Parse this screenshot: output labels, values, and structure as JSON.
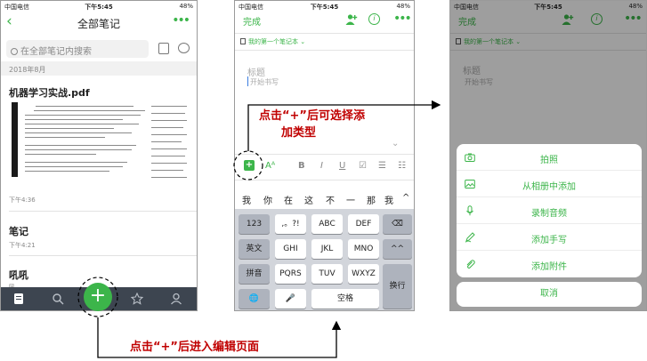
{
  "status_bar": {
    "carrier": "中国电信",
    "time": "下午5:45",
    "battery": "48%"
  },
  "screen_list": {
    "title": "全部笔记",
    "more": "•••",
    "search_placeholder": "在全部笔记内搜索",
    "date_header": "2018年8月",
    "notes": [
      {
        "title": "机器学习实战.pdf",
        "time": "下午4:36"
      },
      {
        "title": "笔记",
        "time": "下午4:21"
      },
      {
        "title": "吼吼",
        "time": "吼 "
      }
    ],
    "fab_label": "+"
  },
  "screen_editor": {
    "done": "完成",
    "info": "i",
    "more": "•••",
    "notebook": "我的第一个笔记本 ⌄",
    "title_placeholder": "标题",
    "body_placeholder": "开始书写",
    "chevron": "⌄",
    "format_plus": "+",
    "format_items": [
      "Aᴬ",
      "B",
      "I",
      "U",
      "☑",
      "☰",
      "☷"
    ],
    "candidates": [
      "我",
      "你",
      "在",
      "这",
      "不",
      "一",
      "那",
      "我",
      "^"
    ],
    "keyboard": {
      "row1": [
        "123",
        ",。?!",
        "ABC",
        "DEF",
        "⌫"
      ],
      "row2": [
        "英文",
        "GHI",
        "JKL",
        "MNO",
        "^^"
      ],
      "row3": [
        "拼音",
        "PQRS",
        "TUV",
        "WXYZ",
        "换行"
      ],
      "row4": [
        "🌐",
        "🎤",
        "空格"
      ]
    }
  },
  "screen_sheet": {
    "done": "完成",
    "info": "i",
    "more": "•••",
    "notebook": "我的第一个笔记本 ⌄",
    "title_placeholder": "标题",
    "body_placeholder": "开始书写",
    "options": [
      "拍照",
      "从相册中添加",
      "录制音频",
      "添加手写",
      "添加附件"
    ],
    "option_icons": [
      "camera-icon",
      "photo-icon",
      "microphone-icon",
      "pen-icon",
      "paperclip-icon"
    ],
    "cancel": "取消"
  },
  "annotations": {
    "choose_type_line1": "点击“+”后可选择添",
    "choose_type_line2": "加类型",
    "enter_editor": "点击“+”后进入编辑页面",
    "color": "#c00000"
  },
  "colors": {
    "accent": "#3cb54a",
    "tabbar": "#3d4550",
    "keyboard": "#d2d5db"
  }
}
